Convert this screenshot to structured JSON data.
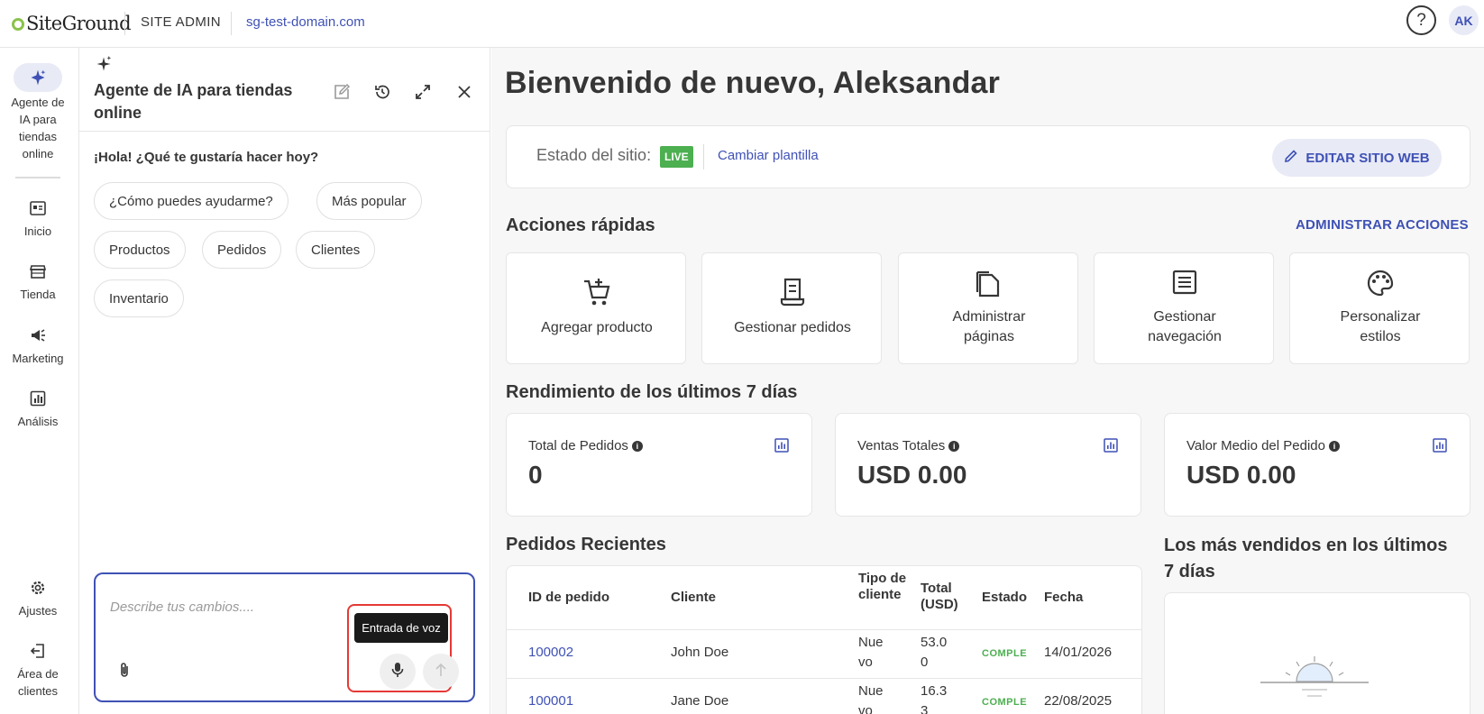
{
  "topbar": {
    "logo_text": "SiteGround",
    "site_admin": "SITE ADMIN",
    "domain": "sg-test-domain.com",
    "help_icon": "help-circle-icon",
    "avatar_initials": "AK"
  },
  "leftnav": {
    "items": [
      {
        "label": "Agente de IA para tiendas online",
        "icon": "sparkle-icon"
      },
      {
        "label": "Inicio",
        "icon": "dashboard-icon"
      },
      {
        "label": "Tienda",
        "icon": "store-icon"
      },
      {
        "label": "Marketing",
        "icon": "megaphone-icon"
      },
      {
        "label": "Análisis",
        "icon": "analytics-icon"
      },
      {
        "label": "Ajustes",
        "icon": "gear-icon"
      },
      {
        "label": "Área de clientes",
        "icon": "exit-icon"
      }
    ]
  },
  "chat": {
    "title": "Agente de IA para tiendas online",
    "greeting": "¡Hola! ¿Qué te gustaría hacer hoy?",
    "chips": [
      "¿Cómo puedes ayudarme?",
      "Más popular",
      "Productos",
      "Pedidos",
      "Clientes",
      "Inventario"
    ],
    "placeholder": "Describe tus cambios....",
    "voice_tooltip": "Entrada de voz"
  },
  "main": {
    "welcome": "Bienvenido de nuevo, Aleksandar",
    "site_status_label": "Estado del sitio:",
    "live_badge": "LIVE",
    "change_template": "Cambiar plantilla",
    "edit_site_button": "EDITAR SITIO WEB",
    "quick_actions_title": "Acciones rápidas",
    "manage_actions": "ADMINISTRAR ACCIONES",
    "quick_actions": [
      {
        "label": "Agregar producto",
        "icon": "add-to-cart-icon"
      },
      {
        "label": "Gestionar pedidos",
        "icon": "receipt-icon"
      },
      {
        "label": "Administrar páginas",
        "icon": "pages-icon"
      },
      {
        "label": "Gestionar navegación",
        "icon": "navigation-list-icon"
      },
      {
        "label": "Personalizar estilos",
        "icon": "palette-icon"
      }
    ],
    "performance_title": "Rendimiento de los últimos 7 días",
    "metrics": [
      {
        "title": "Total de Pedidos",
        "value": "0"
      },
      {
        "title": "Ventas Totales",
        "value": "USD 0.00"
      },
      {
        "title": "Valor Medio del Pedido",
        "value": "USD 0.00"
      }
    ],
    "recent_orders_title": "Pedidos Recientes",
    "orders_table": {
      "headers": [
        "ID de pedido",
        "Cliente",
        "Tipo de cliente",
        "Total (USD)",
        "Estado",
        "Fecha"
      ],
      "rows": [
        {
          "id": "100002",
          "customer": "John Doe",
          "type": "Nue vo",
          "total": "53.0 0",
          "status": "COMPLETADO",
          "date": "14/01/2026"
        },
        {
          "id": "100001",
          "customer": "Jane Doe",
          "type": "Nue vo",
          "total": "16.3 3",
          "status": "COMPLETADO",
          "date": "22/08/2025"
        }
      ]
    },
    "best_sellers_title": "Los más vendidos en los últimos 7 días"
  },
  "colors": {
    "accent": "#3f51b5",
    "accent_soft": "#e8eaf6",
    "live": "#4caf50",
    "highlight": "#e53935"
  }
}
